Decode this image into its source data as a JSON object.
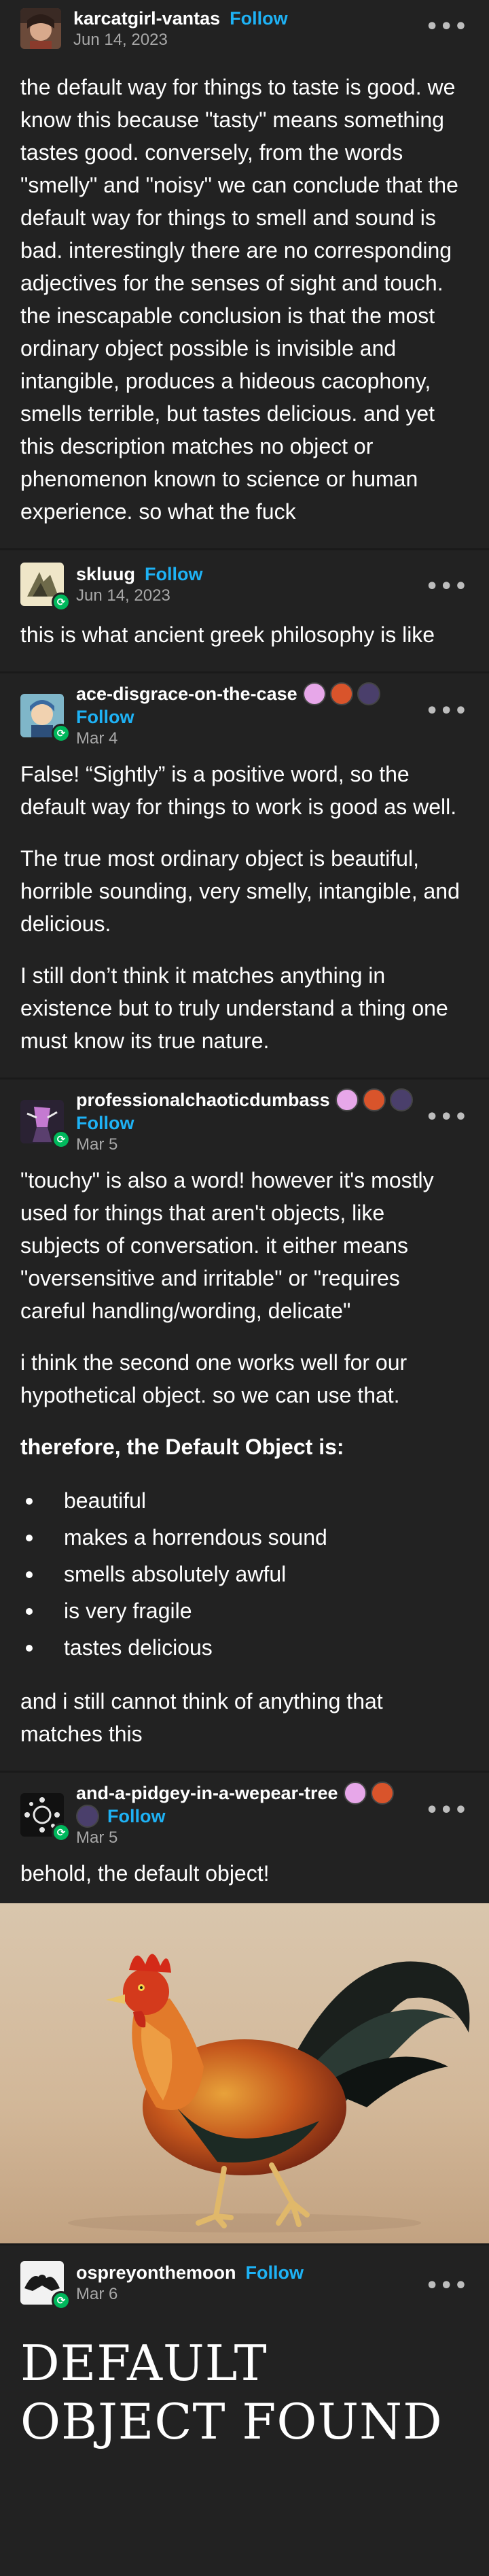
{
  "posts": [
    {
      "username": "karcatgirl-vantas",
      "follow": "Follow",
      "date": "Jun 14, 2023",
      "more": "•••",
      "paragraphs": [
        "the default way for things to taste is good. we know this because \"tasty\" means something tastes good.  conversely, from the words \"smelly\" and \"noisy\" we can conclude that the default way for things to smell and sound is bad.  interestingly there are no corresponding adjectives for the senses of sight and touch.  the inescapable conclusion is that the most ordinary object possible is invisible and intangible, produces a hideous cacophony, smells terrible, but tastes delicious.  and yet this description matches no object or phenomenon known to science or human experience.  so what the fuck"
      ]
    },
    {
      "username": "skluug",
      "follow": "Follow",
      "date": "Jun 14, 2023",
      "more": "•••",
      "paragraphs": [
        "this is what ancient greek philosophy is like"
      ]
    },
    {
      "username": "ace-disgrace-on-the-case",
      "follow": "Follow",
      "date": "Mar 4",
      "more": "•••",
      "paragraphs": [
        "False! “Sightly” is a positive word, so the default way for things to work is good as well.",
        "The true most ordinary object is beautiful, horrible sounding, very smelly, intangible, and delicious.",
        "I still don’t think it matches anything in existence but to truly understand a thing one must know its true nature."
      ]
    },
    {
      "username": "professionalchaoticdumbass",
      "follow": "Follow",
      "date": "Mar 5",
      "more": "•••",
      "paragraphs": [
        "\"touchy\" is also a word! however it's mostly used for things that aren't objects, like subjects of conversation. it either means \"oversensitive and irritable\" or \"requires careful handling/wording, delicate\"",
        "i think the second one works well for our hypothetical object. so we can use that."
      ],
      "bold_line": "therefore, the Default Object is:",
      "bullets": [
        "beautiful",
        "makes a horrendous sound",
        "smells absolutely awful",
        "is very fragile",
        "tastes delicious"
      ],
      "closing": "and i still cannot think of anything that matches this"
    },
    {
      "username": "and-a-pidgey-in-a-wepear-tree",
      "follow": "Follow",
      "date": "Mar 5",
      "more": "•••",
      "paragraphs": [
        "behold, the default object!"
      ]
    },
    {
      "username": "ospreyonthemoon",
      "follow": "Follow",
      "date": "Mar 6",
      "more": "•••",
      "title": "DEFAULT OBJECT FOUND"
    }
  ],
  "colors": {
    "background": "#222222",
    "follow": "#1eb2f5",
    "date": "#a8a8a8",
    "reblog_badge": "#00b85c"
  },
  "icons": {
    "reblog": "reblog-icon",
    "more": "more-options-icon"
  }
}
